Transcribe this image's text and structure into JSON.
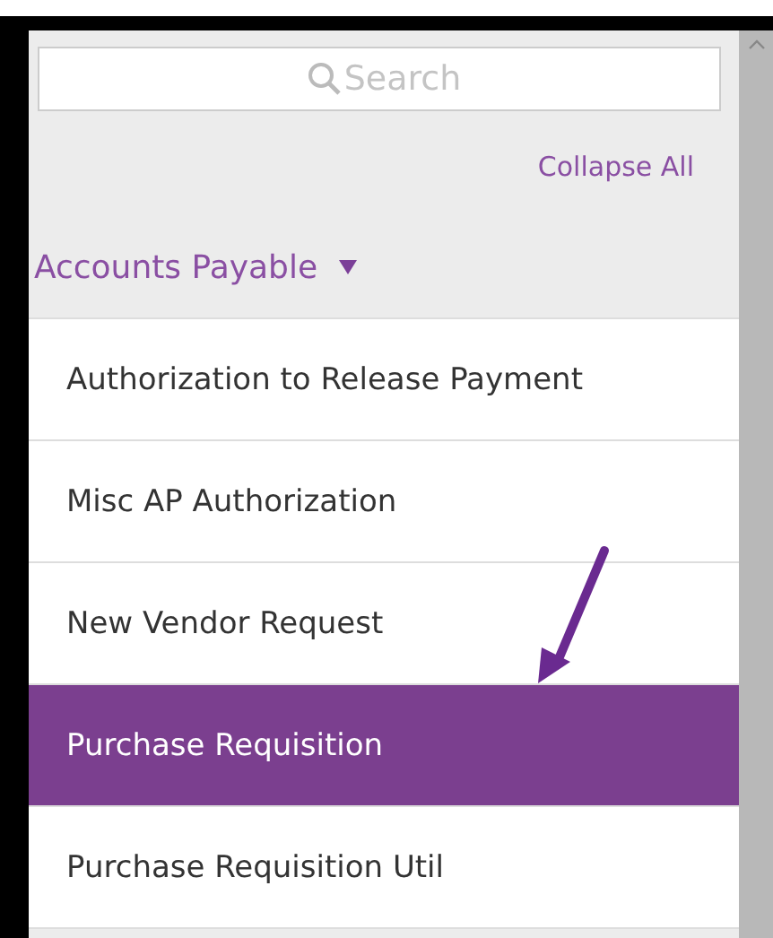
{
  "search": {
    "placeholder": "Search"
  },
  "collapse_link": "Collapse All",
  "group": {
    "label": "Accounts Payable",
    "expanded": true
  },
  "items": [
    {
      "label": "Authorization to Release Payment",
      "selected": false
    },
    {
      "label": "Misc AP Authorization",
      "selected": false
    },
    {
      "label": "New Vendor Request",
      "selected": false
    },
    {
      "label": "Purchase Requisition",
      "selected": true
    },
    {
      "label": "Purchase Requisition Util",
      "selected": false
    }
  ]
}
